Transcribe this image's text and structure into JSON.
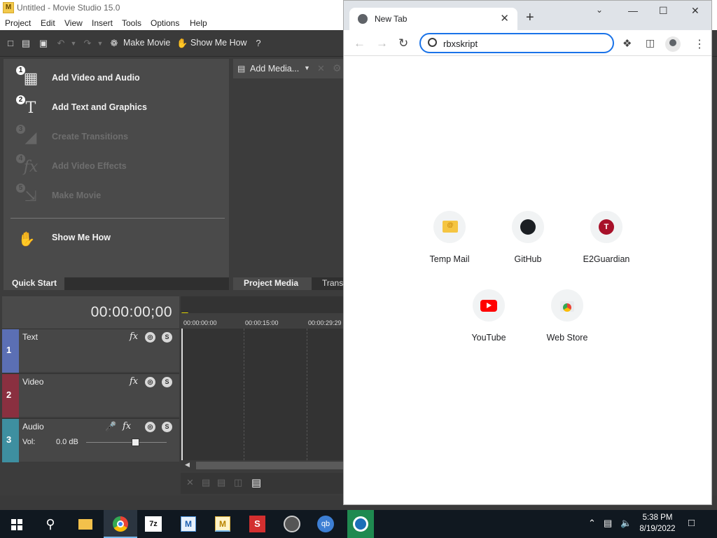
{
  "movie_studio": {
    "title": "Untitled - Movie Studio 15.0",
    "menu": [
      "Project",
      "Edit",
      "View",
      "Insert",
      "Tools",
      "Options",
      "Help"
    ],
    "toolbar": {
      "make_movie": "Make Movie",
      "show_me_how": "Show Me How"
    },
    "quick_start": {
      "items": [
        {
          "num": "1",
          "label": "Add Video and Audio",
          "enabled": true
        },
        {
          "num": "2",
          "label": "Add Text and Graphics",
          "enabled": true
        },
        {
          "num": "3",
          "label": "Create Transitions",
          "enabled": false
        },
        {
          "num": "4",
          "label": "Add Video Effects",
          "enabled": false
        },
        {
          "num": "5",
          "label": "Make Movie",
          "enabled": false
        }
      ],
      "show_me_how": "Show Me How",
      "tab": "Quick Start"
    },
    "project_media": {
      "add_media": "Add Media...",
      "tab": "Project Media",
      "tab2": "Transi"
    },
    "timeline": {
      "timecode": "00:00:00;00",
      "ruler": [
        "00:00:00:00",
        "00:00:15:00",
        "00:00:29:29"
      ],
      "tracks": [
        {
          "num": "1",
          "name": "Text",
          "color": "#5b6fb4"
        },
        {
          "num": "2",
          "name": "Video",
          "color": "#8a3040"
        },
        {
          "num": "3",
          "name": "Audio",
          "color": "#3e8fa0",
          "vol_label": "Vol:",
          "vol_value": "0.0 dB"
        }
      ]
    }
  },
  "chrome": {
    "tab_title": "New Tab",
    "omnibox_value": "rbxskript",
    "shortcuts": [
      {
        "label": "Temp Mail",
        "icon": "temp-mail-icon"
      },
      {
        "label": "GitHub",
        "icon": "github-icon"
      },
      {
        "label": "E2Guardian",
        "icon": "e2guardian-icon",
        "glyph": "T"
      },
      {
        "label": "YouTube",
        "icon": "youtube-icon"
      },
      {
        "label": "Web Store",
        "icon": "web-store-icon"
      }
    ]
  },
  "taskbar": {
    "time": "5:38 PM",
    "date": "8/19/2022",
    "apps": [
      "start",
      "search",
      "file-explorer",
      "chrome",
      "7zip",
      "movie-maker",
      "movie-studio",
      "app-s",
      "app-pen",
      "qbittorrent",
      "app-wave"
    ]
  }
}
